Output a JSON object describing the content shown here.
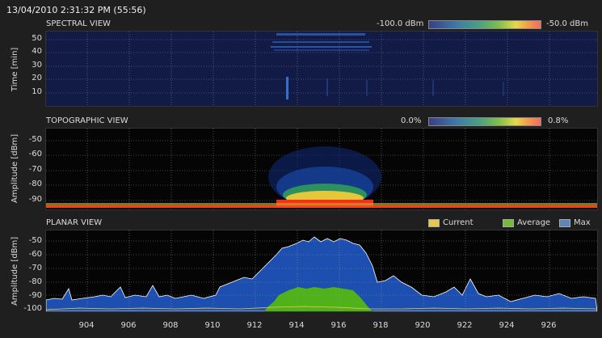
{
  "header": {
    "timestamp": "13/04/2010 2:31:32 PM (55:56)"
  },
  "spectral": {
    "title": "SPECTRAL VIEW",
    "scale_min": "-100.0 dBm",
    "scale_max": "-50.0 dBm",
    "ylabel": "Time [min]",
    "yticks": [
      "50",
      "40",
      "30",
      "20",
      "10"
    ]
  },
  "topographic": {
    "title": "TOPOGRAPHIC VIEW",
    "scale_min": "0.0%",
    "scale_max": "0.8%",
    "ylabel": "Amplitude [dBm]",
    "yticks": [
      "-50",
      "-60",
      "-70",
      "-80",
      "-90"
    ]
  },
  "planar": {
    "title": "PLANAR VIEW",
    "ylabel": "Amplitude [dBm]",
    "yticks": [
      "-50",
      "-60",
      "-70",
      "-80",
      "-90",
      "-100"
    ],
    "legend": [
      {
        "label": "Current",
        "color": "#e8c84a"
      },
      {
        "label": "Average",
        "color": "#77b93b"
      },
      {
        "label": "Max",
        "color": "#5b86b8"
      }
    ]
  },
  "xaxis": {
    "ticks": [
      "904",
      "906",
      "908",
      "910",
      "912",
      "914",
      "916",
      "918",
      "920",
      "922",
      "924",
      "926"
    ]
  },
  "colors": {
    "max_fill": "#1d4fb0",
    "avg_fill": "#4fb21a",
    "current_line": "#e8d23c",
    "grid": "#9a9a9a"
  }
}
